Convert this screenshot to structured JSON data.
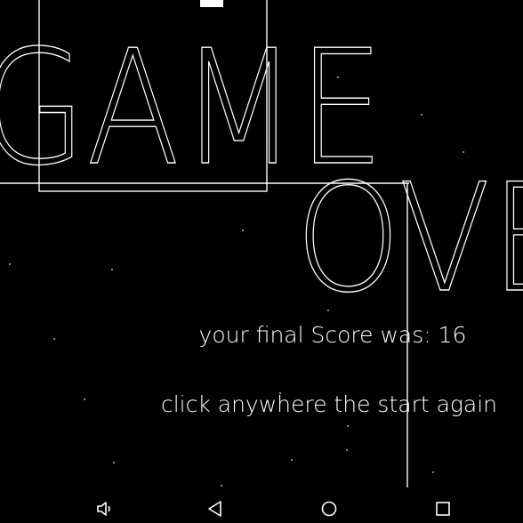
{
  "screen": {
    "headline_word1": "GAME",
    "headline_word2": "OVER",
    "score_label": "your final Score was: 16",
    "restart_hint": "click anywhere the start again"
  },
  "score": 16,
  "icons": {
    "volume": "volume-icon",
    "back": "back-triangle-icon",
    "home": "home-circle-icon",
    "recents": "recents-square-icon"
  },
  "colors": {
    "background": "#000000",
    "foreground": "#ffffff",
    "star": "#8a8a8a"
  }
}
